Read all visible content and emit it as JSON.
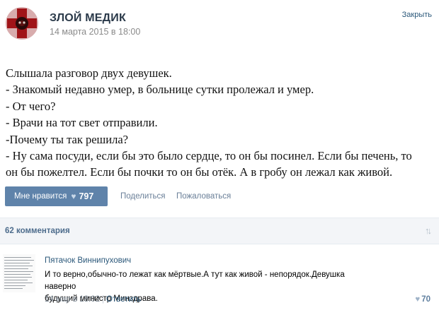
{
  "post": {
    "author": "ЗЛОЙ МЕДИК",
    "date": "14 марта 2015 в 18:00",
    "close_label": "Закрыть",
    "avatar_icon": "red-cross-logo",
    "text_lines": [
      "Слышала разговор двух девушек.",
      "- Знакомый недавно умер, в больнице сутки пролежал и умер.",
      "- От чего?",
      "- Врачи на тот свет отправили.",
      "-Почему ты так решила?",
      "- Ну сама посуди, если бы это было сердце, то он бы посинел. Если бы печень, то",
      "он бы пожелтел. Если бы почки то он бы отёк. А в гробу он лежал как живой."
    ]
  },
  "actions": {
    "like_label": "Мне нравится",
    "like_icon": "heart-icon",
    "like_count": "797",
    "share_label": "Поделиться",
    "report_label": "Пожаловаться"
  },
  "comments": {
    "count_label": "62 комментария",
    "sort_icon": "sort-arrows-icon",
    "items": [
      {
        "author": "Пятачок Виннипухович",
        "text_lines": [
          "И то верно,обычно-то лежат как мёртвые.А тут как живой - непорядок.Девушка наверно",
          "будущий министр Минздрава."
        ],
        "date": "14 мар в 18:02",
        "reply_label": "Ответить",
        "likes": "70"
      }
    ]
  },
  "colors": {
    "accent": "#5f83aa",
    "link": "#2b587a",
    "avatar_red": "#a01418"
  }
}
